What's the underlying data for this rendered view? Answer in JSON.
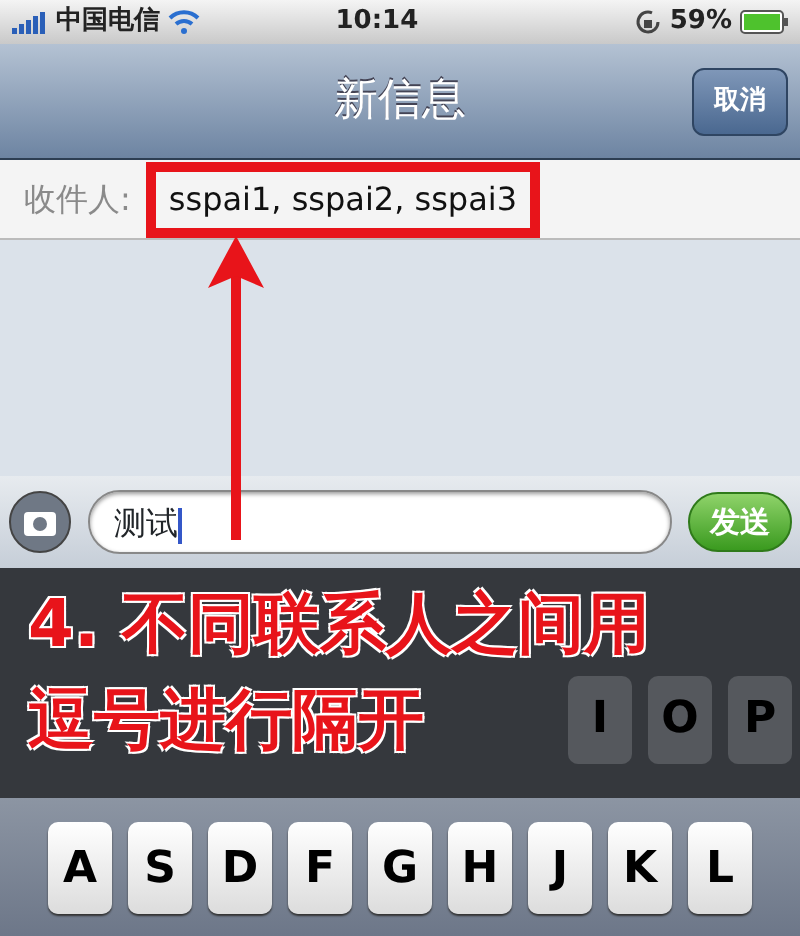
{
  "status_bar": {
    "carrier": "中国电信",
    "time": "10:14",
    "battery": "59%"
  },
  "nav_bar": {
    "title": "新信息",
    "cancel_button": "取消"
  },
  "recipients": {
    "label": "收件人:",
    "value": "sspai1, sspai2, sspai3",
    "highlighted": true
  },
  "compose": {
    "value": "测试",
    "send_button": "发送"
  },
  "annotation": {
    "lines": [
      "4. 不同联系人之间用",
      "逗号进行隔开"
    ]
  },
  "keyboard": {
    "rows": [
      [
        {
          "label": "I"
        },
        {
          "label": "O"
        },
        {
          "label": "P"
        }
      ],
      [
        {
          "label": "A"
        },
        {
          "label": "S"
        },
        {
          "label": "D"
        },
        {
          "label": "F"
        },
        {
          "label": "G"
        },
        {
          "label": "H"
        },
        {
          "label": "J"
        },
        {
          "label": "K"
        },
        {
          "label": "L"
        }
      ]
    ]
  }
}
